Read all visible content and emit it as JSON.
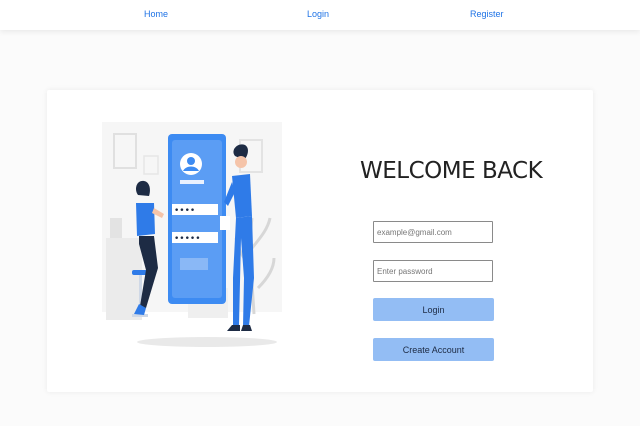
{
  "nav": {
    "home": "Home",
    "login": "Login",
    "register": "Register"
  },
  "form": {
    "title": "WELCOME BACK",
    "email_placeholder": "example@gmail.com",
    "password_placeholder": "Enter password",
    "login_button": "Login",
    "create_account_button": "Create Account"
  },
  "illustration": {
    "password_dots_top": "••••",
    "password_dots_bottom": "•••••"
  },
  "colors": {
    "accent": "#1f73e6",
    "button": "#93bdf4",
    "phone_blue": "#3d8bf2"
  }
}
